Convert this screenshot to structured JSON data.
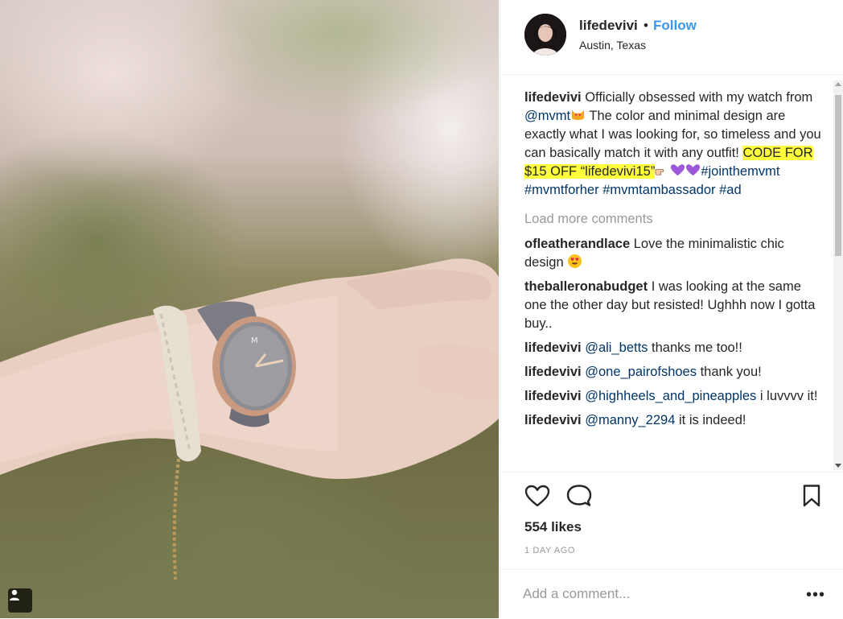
{
  "post": {
    "username": "lifedevivi",
    "separator": "•",
    "follow_label": "Follow",
    "location": "Austin, Texas",
    "profile_badge_icon": "user-icon"
  },
  "caption": {
    "username": "lifedevivi",
    "text_1": "Officially obsessed with my watch from",
    "mention": "@mvmt",
    "text_2": "The color and minimal design are exactly what I was looking for, so timeless and you can basically match it with any outfit!",
    "highlight": "CODE FOR $15 OFF “lifedevivi15”",
    "hashtags": [
      "#jointhemvmt",
      "#mvmtforher",
      "#mvmtambassador",
      "#ad"
    ],
    "highlight_color": "#ffff3c"
  },
  "load_more_label": "Load more comments",
  "comments": [
    {
      "user": "ofleatherandlace",
      "text": "Love the minimalistic chic design",
      "mention": ""
    },
    {
      "user": "theballeronabudget",
      "text": "I was looking at the same one the other day but resisted! Ughhh now I gotta buy..",
      "mention": ""
    },
    {
      "user": "lifedevivi",
      "mention": "@ali_betts",
      "text": "thanks me too!!"
    },
    {
      "user": "lifedevivi",
      "mention": "@one_pairofshoes",
      "text": "thank you!"
    },
    {
      "user": "lifedevivi",
      "mention": "@highheels_and_pineapples",
      "text": "i luvvvv it!"
    },
    {
      "user": "lifedevivi",
      "mention": "@manny_2294",
      "text": "it is indeed!"
    }
  ],
  "actions": {
    "like_icon": "heart-icon",
    "comment_icon": "comment-icon",
    "save_icon": "bookmark-icon"
  },
  "likes_label": "554 likes",
  "date_label": "1 DAY AGO",
  "add_comment_placeholder": "Add a comment...",
  "more_label": "•••",
  "colors": {
    "link": "#003569",
    "follow": "#3897f0",
    "muted": "#999999"
  }
}
